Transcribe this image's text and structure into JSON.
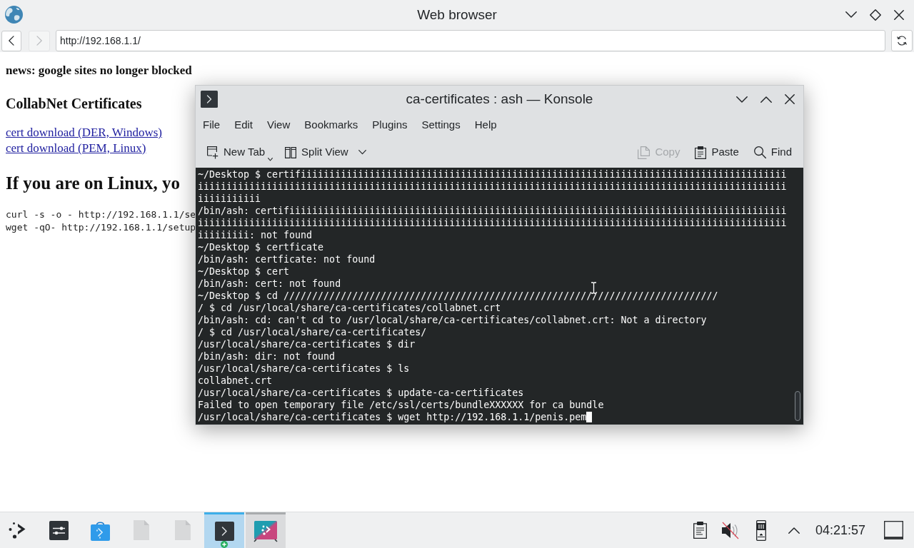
{
  "browser": {
    "title": "Web browser",
    "back": {
      "disabled": false
    },
    "forward": {
      "disabled": true
    },
    "url": "http://192.168.1.1/"
  },
  "page": {
    "news": "news: google sites no longer blocked",
    "heading": "CollabNet Certificates",
    "links": [
      "cert download (DER, Windows)",
      "cert download (PEM, Linux)"
    ],
    "headline": "If you are on Linux, yo",
    "commands": [
      "curl -s -o - http://192.168.1.1/se",
      "wget -qO- http://192.168.1.1/setup"
    ]
  },
  "konsole": {
    "title": "ca-certificates : ash — Konsole",
    "menu": [
      "File",
      "Edit",
      "View",
      "Bookmarks",
      "Plugins",
      "Settings",
      "Help"
    ],
    "toolbar_left": [
      {
        "kind": "newtab",
        "label": "New Tab",
        "disabled": false
      },
      {
        "kind": "split",
        "label": "Split View",
        "disabled": false
      }
    ],
    "toolbar_right": [
      {
        "kind": "copy",
        "label": "Copy",
        "disabled": true
      },
      {
        "kind": "paste",
        "label": "Paste",
        "disabled": false
      },
      {
        "kind": "find",
        "label": "Find",
        "disabled": false
      }
    ],
    "lines": [
      "~/Desktop $ certifiiiiiiiiiiiiiiiiiiiiiiiiiiiiiiiiiiiiiiiiiiiiiiiiiiiiiiiiiiiiiiiiiiiiiiiiiiiiiiiiiiiii",
      "iiiiiiiiiiiiiiiiiiiiiiiiiiiiiiiiiiiiiiiiiiiiiiiiiiiiiiiiiiiiiiiiiiiiiiiiiiiiiiiiiiiiiiiiiiiiiiiiiiiiiii",
      "iiiiiiiiiii",
      "/bin/ash: certifiiiiiiiiiiiiiiiiiiiiiiiiiiiiiiiiiiiiiiiiiiiiiiiiiiiiiiiiiiiiiiiiiiiiiiiiiiiiiiiiiiiiiii",
      "iiiiiiiiiiiiiiiiiiiiiiiiiiiiiiiiiiiiiiiiiiiiiiiiiiiiiiiiiiiiiiiiiiiiiiiiiiiiiiiiiiiiiiiiiiiiiiiiiiiiiii",
      "iiiiiiiii: not found",
      "~/Desktop $ certficate",
      "/bin/ash: certficate: not found",
      "~/Desktop $ cert",
      "/bin/ash: cert: not found",
      "~/Desktop $ cd ////////////////////////////////////////////////////////////////////////////",
      "/ $ cd /usr/local/share/ca-certificates/collabnet.crt",
      "/bin/ash: cd: can't cd to /usr/local/share/ca-certificates/collabnet.crt: Not a directory",
      "/ $ cd /usr/local/share/ca-certificates/",
      "/usr/local/share/ca-certificates $ dir",
      "/bin/ash: dir: not found",
      "/usr/local/share/ca-certificates $ ls",
      "collabnet.crt",
      "/usr/local/share/ca-certificates $ update-ca-certificates",
      "Failed to open temporary file /etc/ssl/certs/bundleXXXXXX for ca bundle",
      "/usr/local/share/ca-certificates $ wget http://192.168.1.1/penis.pem"
    ]
  },
  "taskbar": {
    "tasks": [
      {
        "selected": true
      },
      {
        "selected": false
      }
    ],
    "clock": "04:21:57"
  }
}
